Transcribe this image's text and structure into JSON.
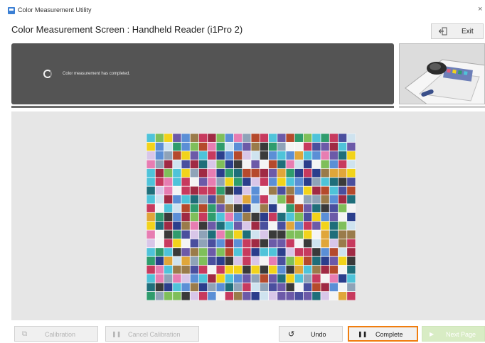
{
  "window": {
    "title": "Color Measurement Utility",
    "close_glyph": "×"
  },
  "screen": {
    "title": "Color Measurement Screen : Handheld Reader (i1Pro 2)"
  },
  "header": {
    "exit_label": "Exit",
    "exit_icon": "exit-door-icon"
  },
  "status": {
    "message": "Color measurement has completed.",
    "icon": "spinner-icon"
  },
  "preview": {
    "description_icon": "handheld-reader-device-icon"
  },
  "colors": {
    "accent_highlight": "#f07d0e",
    "next_button_bg": "#d8ecc4",
    "panel_bg": "#545454",
    "palette": [
      "#2b3e8c",
      "#c73a5e",
      "#f2d31b",
      "#2f9c6d",
      "#6c5aa8",
      "#e77db2",
      "#3a3a3a",
      "#f4f4f4",
      "#5b8fd6",
      "#4fc3d9",
      "#9a7b4a",
      "#7fbf5a",
      "#d8c6e8",
      "#b54a2c",
      "#1f6e7a",
      "#8fa3b8",
      "#e0a63a",
      "#a02a44",
      "#4a4f9e",
      "#cfe3ef"
    ]
  },
  "chart": {
    "rows": 19,
    "cols": 24,
    "seed": 7
  },
  "toolbar": {
    "calibration": {
      "label": "Calibration",
      "icon": "calibration-icon",
      "icon_glyph": "⧉"
    },
    "cancel_calibration": {
      "label": "Cancel Calibration",
      "icon": "pause-icon",
      "icon_glyph": "❚❚"
    },
    "undo": {
      "label": "Undo",
      "icon": "undo-icon",
      "icon_glyph": "↺"
    },
    "complete": {
      "label": "Complete",
      "icon": "pause-icon",
      "icon_glyph": "❚❚"
    },
    "next_page": {
      "label": "Next Page",
      "icon": "play-icon",
      "icon_glyph": "▶"
    }
  }
}
